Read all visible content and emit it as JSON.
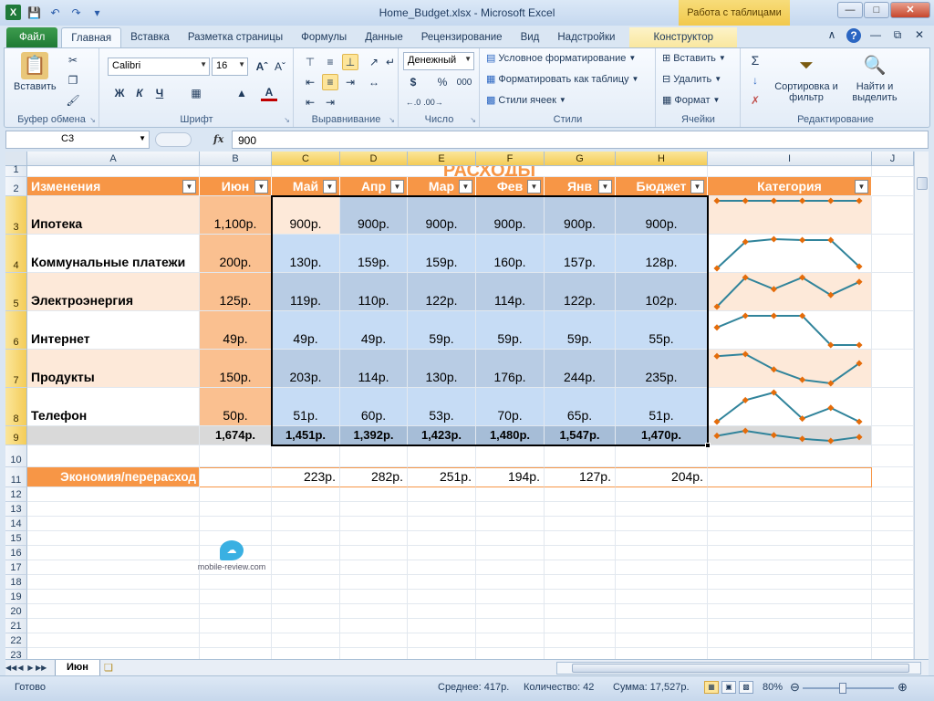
{
  "window": {
    "title": "Home_Budget.xlsx - Microsoft Excel",
    "context_tab_group": "Работа с таблицами"
  },
  "tabs": [
    "Файл",
    "Главная",
    "Вставка",
    "Разметка страницы",
    "Формулы",
    "Данные",
    "Рецензирование",
    "Вид",
    "Надстройки",
    "Конструктор"
  ],
  "ribbon": {
    "clipboard": {
      "label": "Буфер обмена",
      "paste": "Вставить"
    },
    "font": {
      "label": "Шрифт",
      "name": "Calibri",
      "size": "16",
      "bold": "Ж",
      "italic": "К",
      "underline": "Ч"
    },
    "alignment": {
      "label": "Выравнивание"
    },
    "number": {
      "label": "Число",
      "format": "Денежный",
      "currency": "$",
      "percent": "%",
      "thousands": "000"
    },
    "styles": {
      "label": "Стили",
      "conditional": "Условное форматирование",
      "as_table": "Форматировать как таблицу",
      "cell_styles": "Стили ячеек"
    },
    "cells": {
      "label": "Ячейки",
      "insert": "Вставить",
      "delete": "Удалить",
      "format": "Формат"
    },
    "editing": {
      "label": "Редактирование",
      "sort": "Сортировка и фильтр",
      "find": "Найти и выделить"
    }
  },
  "formula_bar": {
    "name_box": "C3",
    "fx": "fx",
    "value": "900"
  },
  "columns": [
    "A",
    "B",
    "C",
    "D",
    "E",
    "F",
    "G",
    "H",
    "I",
    "J"
  ],
  "rows": [
    "1",
    "2",
    "3",
    "4",
    "5",
    "6",
    "7",
    "8",
    "9",
    "10",
    "11",
    "12",
    "13",
    "14",
    "15",
    "16",
    "17",
    "18",
    "19",
    "20",
    "21",
    "22",
    "23"
  ],
  "sheet": {
    "title": "РАСХОДЫ",
    "headers": [
      "Изменения",
      "Июн",
      "Май",
      "Апр",
      "Мар",
      "Фев",
      "Янв",
      "Бюджет",
      "Категория"
    ],
    "data": [
      {
        "name": "Ипотека",
        "values": [
          "1,100р.",
          "900р.",
          "900р.",
          "900р.",
          "900р.",
          "900р.",
          "900р."
        ]
      },
      {
        "name": "Коммунальные платежи",
        "values": [
          "200р.",
          "130р.",
          "159р.",
          "159р.",
          "160р.",
          "157р.",
          "128р."
        ]
      },
      {
        "name": "Электроэнергия",
        "values": [
          "125р.",
          "119р.",
          "110р.",
          "122р.",
          "114р.",
          "122р.",
          "102р."
        ]
      },
      {
        "name": "Интернет",
        "values": [
          "49р.",
          "49р.",
          "49р.",
          "59р.",
          "59р.",
          "59р.",
          "55р."
        ]
      },
      {
        "name": "Продукты",
        "values": [
          "150р.",
          "203р.",
          "114р.",
          "130р.",
          "176р.",
          "244р.",
          "235р."
        ]
      },
      {
        "name": "Телефон",
        "values": [
          "50р.",
          "51р.",
          "60р.",
          "53р.",
          "70р.",
          "65р.",
          "51р."
        ]
      }
    ],
    "totals": [
      "1,674р.",
      "1,451р.",
      "1,392р.",
      "1,423р.",
      "1,480р.",
      "1,547р.",
      "1,470р."
    ],
    "savings_label": "Экономия/перерасход",
    "savings": [
      "223р.",
      "282р.",
      "251р.",
      "194р.",
      "127р.",
      "204р."
    ],
    "sparklines": [
      [
        900,
        900,
        900,
        900,
        900,
        900
      ],
      [
        128,
        157,
        160,
        159,
        159,
        130
      ],
      [
        102,
        122,
        114,
        122,
        110,
        119
      ],
      [
        55,
        59,
        59,
        59,
        49,
        49
      ],
      [
        235,
        244,
        176,
        130,
        114,
        203
      ],
      [
        51,
        65,
        70,
        53,
        60,
        51
      ],
      [
        1470,
        1547,
        1480,
        1423,
        1392,
        1451
      ]
    ],
    "watermark": "mobile-review.com"
  },
  "sheet_tab": "Июн",
  "status": {
    "ready": "Готово",
    "average": "Среднее: 417р.",
    "count": "Количество: 42",
    "sum": "Сумма: 17,527р.",
    "zoom": "80%"
  },
  "colors": {
    "header": "#f79646",
    "title": "#f79646",
    "row_light": "#fde9d9",
    "jun": "#fac090",
    "sel_dark": "#b8cce4",
    "sel_light": "#c6dcf5",
    "total_row": "#d9d9d9",
    "spark": "#31849b",
    "marker": "#e46c0a"
  }
}
